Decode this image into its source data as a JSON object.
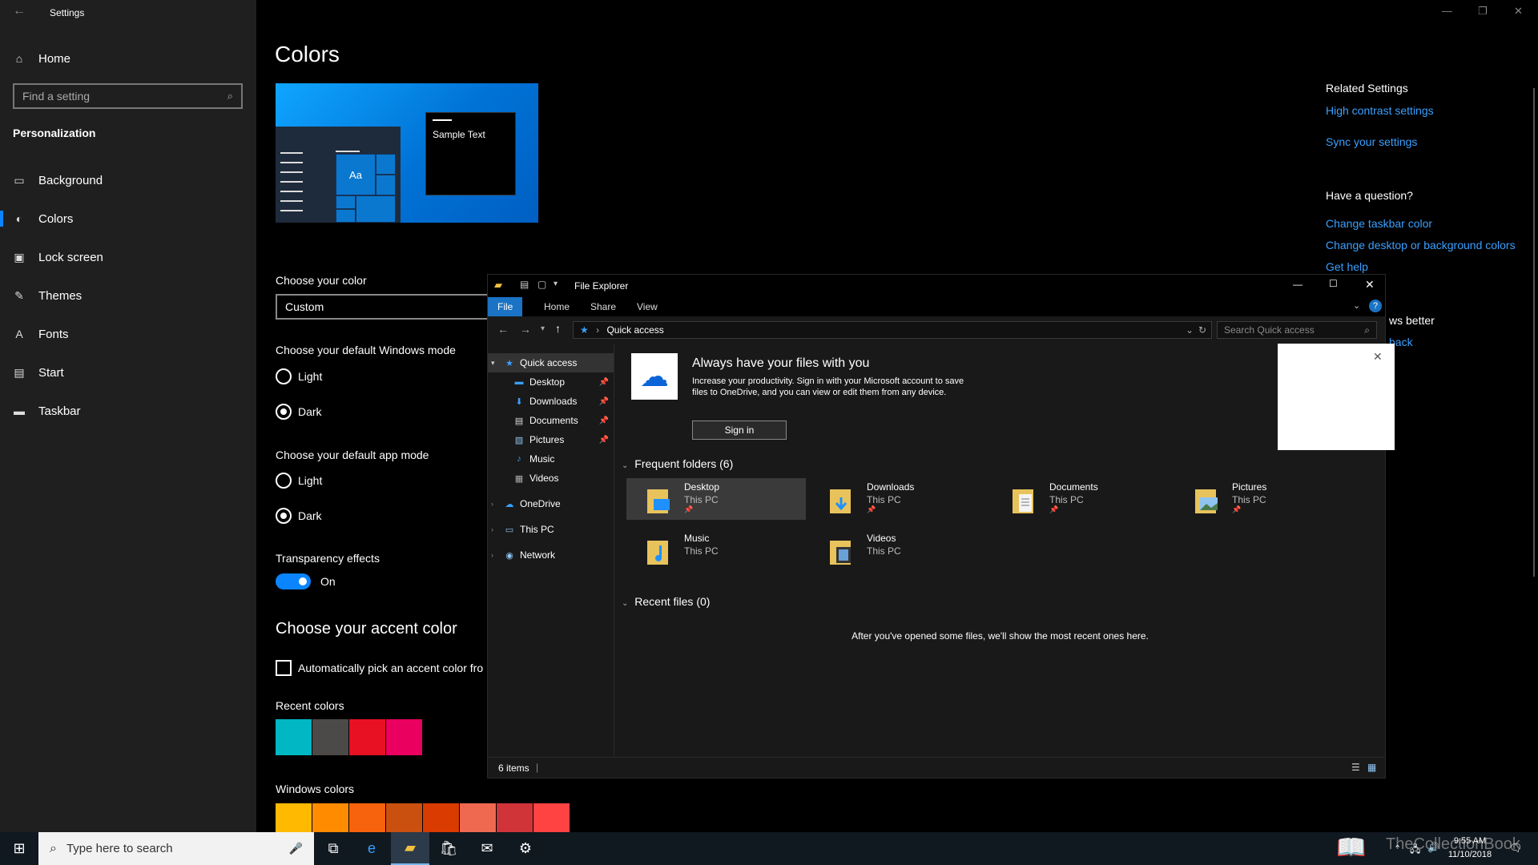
{
  "settings": {
    "window_title": "Settings",
    "home": "Home",
    "search_placeholder": "Find a setting",
    "section": "Personalization",
    "nav": [
      {
        "label": "Background",
        "icon": "image-icon"
      },
      {
        "label": "Colors",
        "icon": "palette-icon"
      },
      {
        "label": "Lock screen",
        "icon": "lock-screen-icon"
      },
      {
        "label": "Themes",
        "icon": "brush-icon"
      },
      {
        "label": "Fonts",
        "icon": "font-icon"
      },
      {
        "label": "Start",
        "icon": "start-icon"
      },
      {
        "label": "Taskbar",
        "icon": "taskbar-icon"
      }
    ],
    "page_title": "Colors",
    "preview_text": "Sample Text",
    "preview_tile_label": "Aa",
    "choose_color_label": "Choose your color",
    "choose_color_value": "Custom",
    "windows_mode_label": "Choose your default Windows mode",
    "windows_mode_options": [
      "Light",
      "Dark"
    ],
    "windows_mode_selected": "Dark",
    "app_mode_label": "Choose your default app mode",
    "app_mode_options": [
      "Light",
      "Dark"
    ],
    "app_mode_selected": "Dark",
    "transparency_label": "Transparency effects",
    "transparency_state": "On",
    "accent_title": "Choose your accent color",
    "auto_accent_label": "Automatically pick an accent color fro",
    "recent_colors_label": "Recent colors",
    "recent_colors": [
      "#00b7c3",
      "#4c4a48",
      "#e81123",
      "#ea005e"
    ],
    "windows_colors_label": "Windows colors",
    "windows_colors": [
      "#ffb900",
      "#ff8c00",
      "#f7630c",
      "#ca5010",
      "#da3b01",
      "#ef6950",
      "#d13438",
      "#ff4343"
    ],
    "related_settings": {
      "title": "Related Settings",
      "links": [
        "High contrast settings",
        "Sync your settings"
      ]
    },
    "question": {
      "title": "Have a question?",
      "links": [
        "Change taskbar color",
        "Change desktop or background colors",
        "Get help"
      ]
    },
    "partial_text_1": "ws better",
    "partial_text_2": "back"
  },
  "explorer": {
    "title": "File Explorer",
    "ribbon_tabs": [
      "File",
      "Home",
      "Share",
      "View"
    ],
    "address": "Quick access",
    "search_placeholder": "Search Quick access",
    "nav": {
      "quick_access": "Quick access",
      "pinned": [
        "Desktop",
        "Downloads",
        "Documents",
        "Pictures"
      ],
      "unpinned": [
        "Music",
        "Videos"
      ],
      "roots": [
        "OneDrive",
        "This PC",
        "Network"
      ]
    },
    "onedrive": {
      "title": "Always have your files with you",
      "text": "Increase your productivity. Sign in with your Microsoft account to save files to OneDrive, and you can view or edit them from any device.",
      "button": "Sign in"
    },
    "frequent_header": "Frequent folders (6)",
    "folders": [
      {
        "name": "Desktop",
        "location": "This PC",
        "pinned": true
      },
      {
        "name": "Downloads",
        "location": "This PC",
        "pinned": true
      },
      {
        "name": "Documents",
        "location": "This PC",
        "pinned": true
      },
      {
        "name": "Pictures",
        "location": "This PC",
        "pinned": true
      },
      {
        "name": "Music",
        "location": "This PC",
        "pinned": false
      },
      {
        "name": "Videos",
        "location": "This PC",
        "pinned": false
      }
    ],
    "recent_header": "Recent files (0)",
    "recent_empty": "After you've opened some files, we'll show the most recent ones here.",
    "status": "6 items"
  },
  "taskbar": {
    "search_placeholder": "Type here to search",
    "time": "9:55 AM",
    "date": "11/10/2018",
    "watermark": "TheCollectionBook"
  },
  "colors": {
    "accent": "#0a84ff",
    "link": "#3aa0ff",
    "ribbon_file": "#1a73c4"
  }
}
